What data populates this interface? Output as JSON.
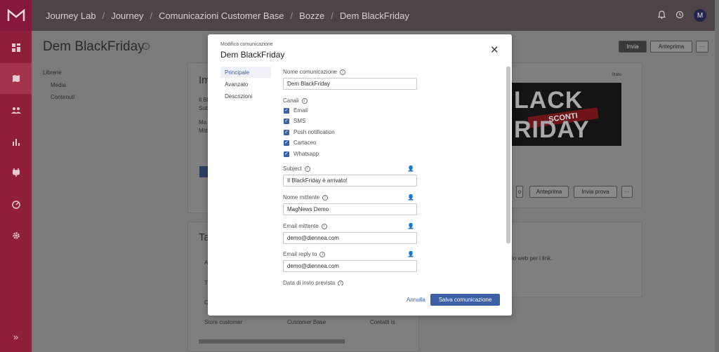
{
  "breadcrumb": [
    "Journey Lab",
    "Journey",
    "Comunicazioni Customer Base",
    "Bozze",
    "Dem BlackFriday"
  ],
  "user": {
    "avatar_initial": "M"
  },
  "page": {
    "title": "Dem BlackFriday",
    "buttons": {
      "send": "Invia",
      "preview": "Anteprima",
      "more": "···"
    },
    "library": {
      "heading": "Librerie",
      "items": [
        "Media",
        "Contenuti"
      ]
    },
    "background": {
      "card1_heading": "Im",
      "card1_lines": [
        "Il Bl",
        "Sub",
        "Ma",
        "Mitt"
      ],
      "card2_heading": "Ta",
      "card2_rows": [
        "A",
        "T",
        "C"
      ],
      "banner_label": "Stato",
      "banner_words": [
        "LACK",
        "SCONTI",
        "RIDAY"
      ],
      "card3_text": "io web per i link.",
      "email_buttons": [
        "o",
        "Anteprima",
        "Invia prova",
        "···"
      ],
      "table_row": [
        "Store customer",
        "Customer Base",
        "Contatti is"
      ]
    }
  },
  "modal": {
    "subtitle": "Modifica comunicazione",
    "title": "Dem BlackFriday",
    "tabs": [
      "Principale",
      "Avanzato",
      "Descrizioni"
    ],
    "fields": {
      "name_label": "Nome comunicazione",
      "name_value": "Dem BlackFriday",
      "channels_label": "Canali",
      "channels": [
        "Email",
        "SMS",
        "Push notification",
        "Cartaceo",
        "Whatsapp"
      ],
      "subject_label": "Subject",
      "subject_value": "Il BlackFriday è arrivato!",
      "sender_name_label": "Nome mittente",
      "sender_name_value": "MagNews Demo",
      "sender_email_label": "Email mittente",
      "sender_email_value": "demo@diennea.com",
      "reply_label": "Email reply to",
      "reply_value": "demo@diennea.com",
      "date_label": "Data di invio prevista"
    },
    "cancel_label": "Annulla",
    "save_label": "Salva comunicazione"
  },
  "colors": {
    "brand": "#8f1f3a",
    "accent": "#3c5fa6"
  }
}
